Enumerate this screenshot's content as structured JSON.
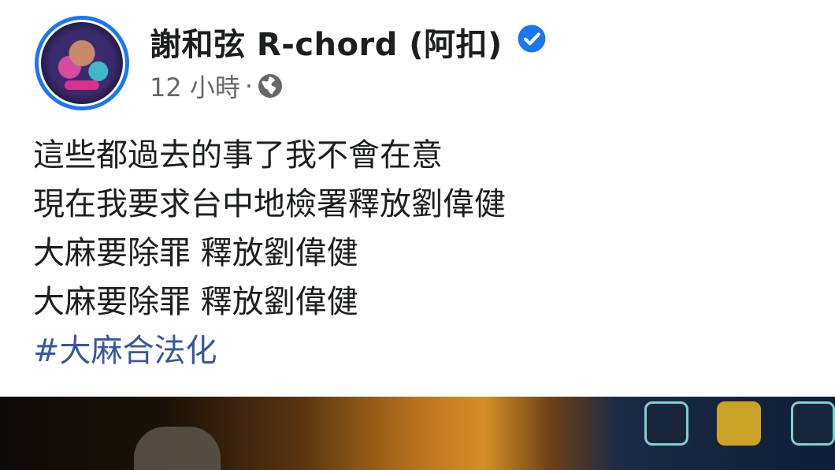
{
  "post": {
    "author": {
      "name": "謝和弦 R-chord (阿扣)",
      "verified": true,
      "avatar": "profile-photo"
    },
    "meta": {
      "time": "12 小時",
      "separator": "·",
      "privacy_icon": "globe-icon"
    },
    "lines": [
      "這些都過去的事了我不會在意",
      "現在我要求台中地檢署釋放劉偉健",
      "大麻要除罪 釋放劉偉健",
      "大麻要除罪 釋放劉偉健"
    ],
    "hashtag": "#大麻合法化",
    "media": {
      "icons": [
        "app-icon",
        "app-icon",
        "app-icon"
      ]
    }
  },
  "colors": {
    "accent": "#1877f2",
    "link": "#385898",
    "text": "#1c1e21",
    "meta": "#65676b"
  }
}
